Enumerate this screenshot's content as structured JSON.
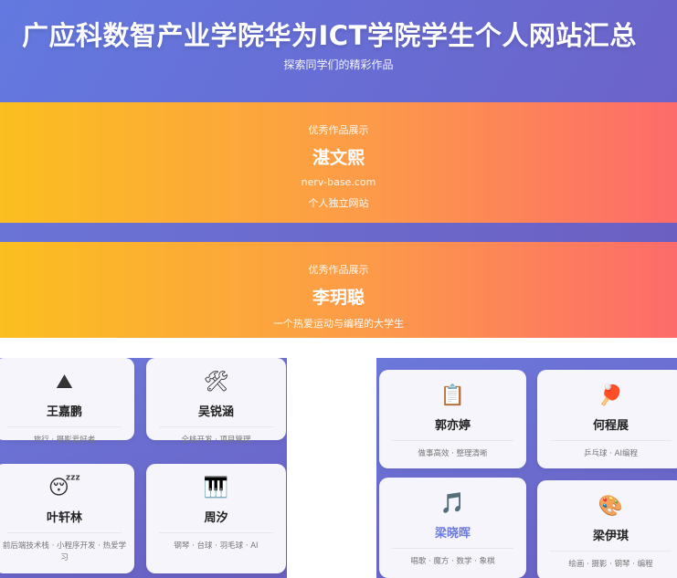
{
  "hero": {
    "title": "广应科数智产业学院华为ICT学院学生个人网站汇总",
    "subtitle": "探索同学们的精彩作品"
  },
  "featured": [
    {
      "kicker": "优秀作品展示",
      "name": "湛文熙",
      "link": "nerv-base.com",
      "desc": "个人独立网站"
    },
    {
      "kicker": "优秀作品展示",
      "name": "李玥聪",
      "desc": "一个热爱运动与编程的大学生"
    }
  ],
  "students_left": [
    {
      "icon": "⛰",
      "icon_name": "mountain-icon",
      "name": "王嘉鹏",
      "tags": "旅行 · 摄影爱好者"
    },
    {
      "icon": "🛠",
      "icon_name": "tools-icon",
      "name": "吴锐涵",
      "tags": "全栈开发 · 项目管理"
    },
    {
      "icon": "😴",
      "icon_name": "sleepy-face-icon",
      "name": "叶轩林",
      "tags": "前后端技术栈 · 小程序开发 · 热爱学习"
    },
    {
      "icon": "🎹",
      "icon_name": "piano-icon",
      "name": "周汐",
      "tags": "钢琴 · 台球 · 羽毛球 · AI"
    }
  ],
  "students_right": [
    {
      "icon": "📋",
      "icon_name": "clipboard-icon",
      "name": "郭亦婷",
      "tags": "做事高效 · 整理清晰"
    },
    {
      "icon": "🏓",
      "icon_name": "ping-pong-icon",
      "name": "何程展",
      "tags": "乒乓球 · AI编程"
    },
    {
      "icon": "🎵",
      "icon_name": "music-notes-icon",
      "name": "梁晓晖",
      "tags": "唱歌 · 魔方 · 数学 · 象棋"
    },
    {
      "icon": "🎨",
      "icon_name": "palette-icon",
      "name": "梁伊琪",
      "tags": "绘画 · 摄影 · 钢琴 · 编程"
    }
  ]
}
